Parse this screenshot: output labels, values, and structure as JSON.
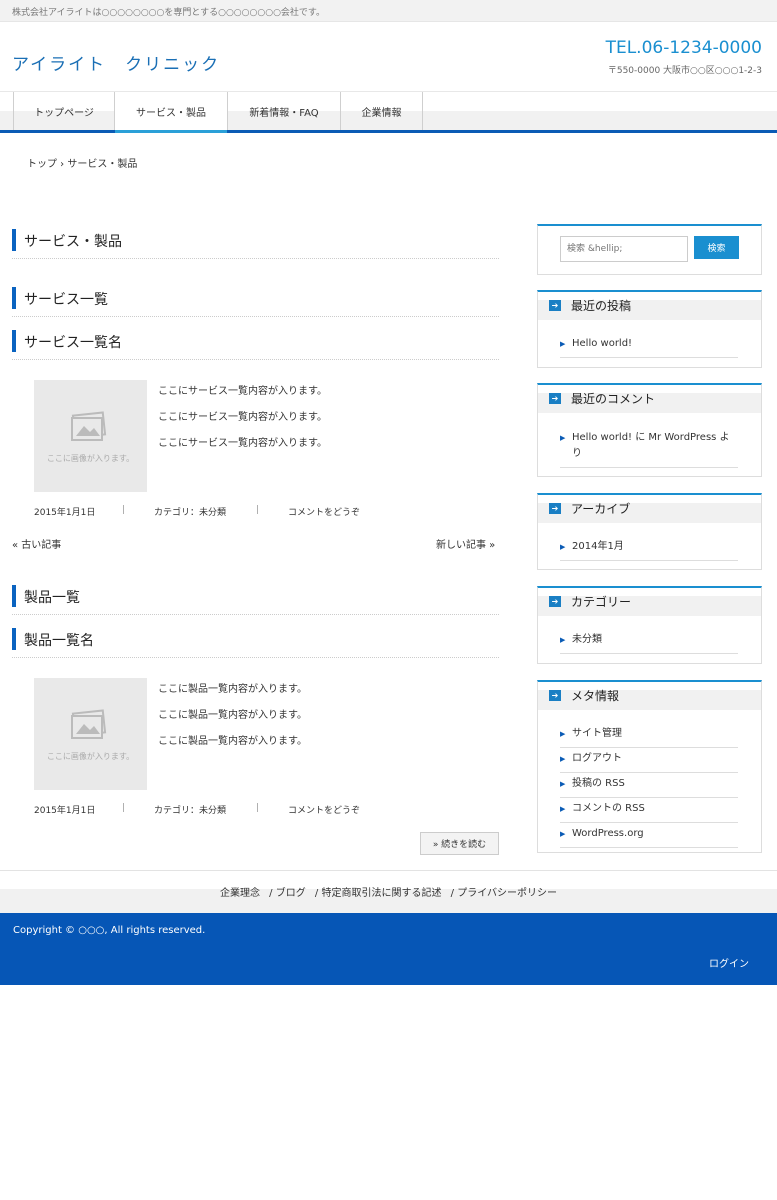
{
  "topbar": {
    "tagline": "株式会社アイライトは○○○○○○○○を専門とする○○○○○○○○会社です。"
  },
  "header": {
    "site_title": "アイライト　クリニック",
    "tel": "TEL.06-1234-0000",
    "address": "〒550-0000 大阪市○○区○○○1-2-3"
  },
  "nav": {
    "items": [
      {
        "label": "トップページ"
      },
      {
        "label": "サービス・製品",
        "active": true
      },
      {
        "label": "新着情報・FAQ"
      },
      {
        "label": "企業情報"
      }
    ]
  },
  "breadcrumb": "トップ › サービス・製品",
  "main": {
    "page_title": "サービス・製品",
    "services": {
      "heading": "サービス一覧",
      "item_title": "サービス一覧名",
      "image_placeholder": "ここに画像が入ります。",
      "lines": [
        "ここにサービス一覧内容が入ります。",
        "ここにサービス一覧内容が入ります。",
        "ここにサービス一覧内容が入ります。"
      ],
      "date": "2015年1月1日",
      "category": "カテゴリ：未分類",
      "comment": "コメントをどうぞ",
      "older": "« 古い記事",
      "newer": "新しい記事 »"
    },
    "products": {
      "heading": "製品一覧",
      "item_title": "製品一覧名",
      "image_placeholder": "ここに画像が入ります。",
      "lines": [
        "ここに製品一覧内容が入ります。",
        "ここに製品一覧内容が入ります。",
        "ここに製品一覧内容が入ります。"
      ],
      "date": "2015年1月1日",
      "category": "カテゴリ：未分類",
      "comment": "コメントをどうぞ",
      "read_more": "» 続きを読む"
    }
  },
  "sidebar": {
    "search": {
      "placeholder": "検索 &hellip;",
      "button": "検索"
    },
    "recent_posts": {
      "title": "最近の投稿",
      "items": [
        "Hello world!"
      ]
    },
    "recent_comments": {
      "title": "最近のコメント",
      "items": [
        "Hello world! に Mr WordPress より"
      ]
    },
    "archives": {
      "title": "アーカイブ",
      "items": [
        "2014年1月"
      ]
    },
    "categories": {
      "title": "カテゴリー",
      "items": [
        "未分類"
      ]
    },
    "meta": {
      "title": "メタ情報",
      "items": [
        "サイト管理",
        "ログアウト",
        "投稿の RSS",
        "コメントの RSS",
        "WordPress.org"
      ]
    }
  },
  "footer": {
    "links": [
      "企業理念",
      "/ ブログ",
      "/ 特定商取引法に関する記述",
      "/ プライバシーポリシー"
    ],
    "copyright": "Copyright © ○○○, All rights reserved.",
    "login": "ログイン"
  },
  "colors": {
    "accent": "#0a5bb5",
    "title": "#1a6fb5",
    "footer_bg": "#0656b6"
  }
}
